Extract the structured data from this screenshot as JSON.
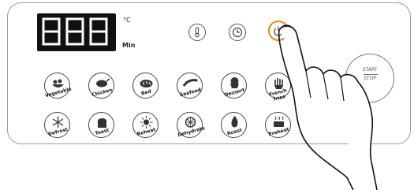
{
  "display": {
    "digits": "888",
    "unit_temp": "°C",
    "unit_time": "Min"
  },
  "top_buttons": [
    {
      "name": "temperature-button",
      "icon": "thermometer-icon"
    },
    {
      "name": "timer-button",
      "icon": "clock-icon"
    },
    {
      "name": "power-button",
      "icon": "power-icon",
      "accent": "#e8871a"
    }
  ],
  "functions_row1": [
    {
      "label": "Vegetable",
      "icon": "vegetable-icon"
    },
    {
      "label": "Chicken",
      "icon": "chicken-icon"
    },
    {
      "label": "Bed",
      "icon": "bread-icon"
    },
    {
      "label": "Seafood",
      "icon": "seafood-icon"
    },
    {
      "label": "Dessert",
      "icon": "cupcake-icon"
    },
    {
      "label": "French fries",
      "icon": "fries-icon"
    }
  ],
  "functions_row2": [
    {
      "label": "Defrost",
      "icon": "snowflake-icon"
    },
    {
      "label": "Toast",
      "icon": "toast-icon"
    },
    {
      "label": "Reheat",
      "icon": "sun-icon"
    },
    {
      "label": "Dehydrate",
      "icon": "citrus-icon"
    },
    {
      "label": "Roast",
      "icon": "flame-icon"
    },
    {
      "label": "Preheat",
      "icon": "steam-pot-icon"
    }
  ],
  "start_stop": {
    "start_label": "START",
    "stop_label": "STOP"
  }
}
